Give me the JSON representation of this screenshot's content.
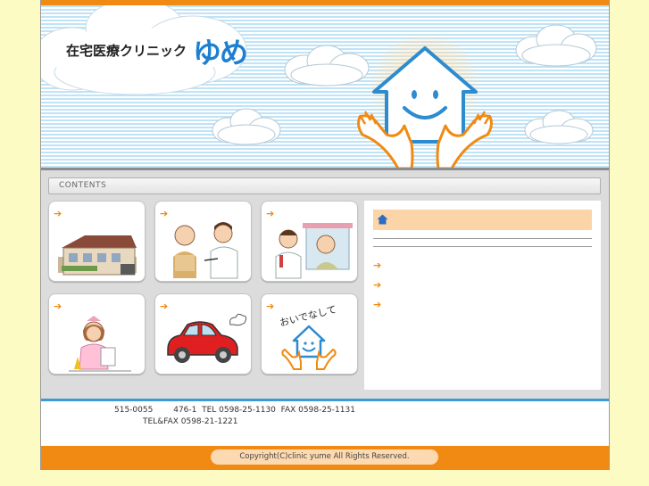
{
  "header": {
    "clinic_name": "在宅医療クリニック",
    "clinic_name_brand": "ゆめ"
  },
  "contents_label": "CONTENTS",
  "tiles": [
    {
      "arrow": "➔",
      "icon": "clinic-building-icon"
    },
    {
      "arrow": "➔",
      "icon": "doctor-patient-icon"
    },
    {
      "arrow": "➔",
      "icon": "home-visit-icon"
    },
    {
      "arrow": "➔",
      "icon": "nurse-icon"
    },
    {
      "arrow": "➔",
      "icon": "car-icon"
    },
    {
      "arrow": "➔",
      "icon": "oidenashite-logo-icon"
    }
  ],
  "oidenashite_text": "おいでなして",
  "info_panel": {
    "arrows": [
      "➔",
      "➔",
      "➔"
    ]
  },
  "footer": {
    "address_line1": "515-0055        476-1  TEL 0598-25-1130  FAX 0598-25-1131",
    "address_line2": "TEL&FAX 0598-21-1221",
    "copyright": "Copyright(C)clinic yume All Rights Reserved."
  },
  "colors": {
    "accent_orange": "#f08a12",
    "brand_blue": "#1e7fd0",
    "page_background": "#fdfbc4"
  }
}
